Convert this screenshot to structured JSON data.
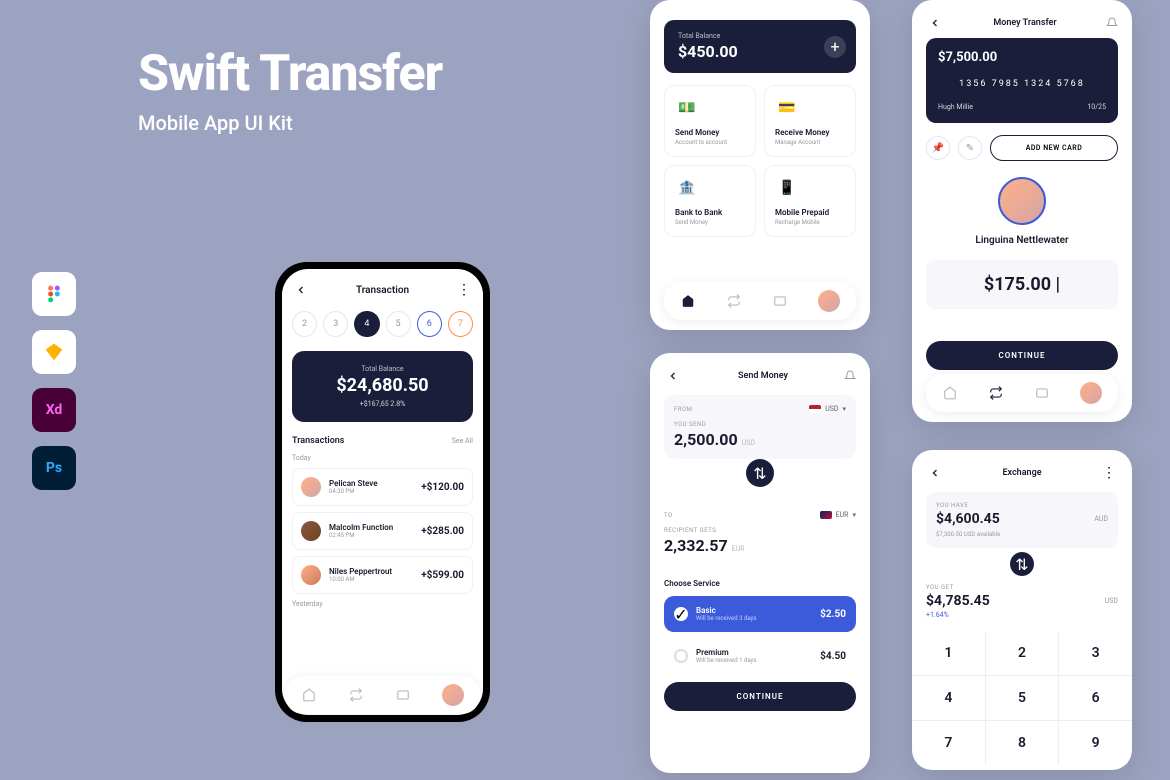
{
  "hero": {
    "title": "Swift Transfer",
    "subtitle": "Mobile App UI Kit"
  },
  "tools": [
    "Figma",
    "Sketch",
    "XD",
    "Photoshop"
  ],
  "transaction_screen": {
    "title": "Transaction",
    "tabs": [
      "2",
      "3",
      "4",
      "5",
      "6",
      "7"
    ],
    "active_tab": "4",
    "balance_label": "Total Balance",
    "balance": "$24,680.50",
    "change": "+$167,65   2.8%",
    "section": "Transactions",
    "see_all": "See All",
    "today": "Today",
    "yesterday": "Yesterday",
    "items": [
      {
        "name": "Pelican Steve",
        "time": "04:30 PM",
        "amount": "+$120.00"
      },
      {
        "name": "Malcolm Function",
        "time": "02:45 PM",
        "amount": "+$285.00"
      },
      {
        "name": "Niles Peppertrout",
        "time": "10:00 AM",
        "amount": "+$599.00"
      }
    ]
  },
  "home_screen": {
    "balance_label": "Total Balance",
    "balance": "$450.00",
    "actions": [
      {
        "title": "Send Money",
        "sub": "Account to account"
      },
      {
        "title": "Receive Money",
        "sub": "Manage Account"
      },
      {
        "title": "Bank to Bank",
        "sub": "Send Money"
      },
      {
        "title": "Mobile Prepaid",
        "sub": "Recharge Mobile"
      }
    ]
  },
  "send_screen": {
    "title": "Send Money",
    "from": "FROM",
    "from_currency": "USD",
    "you_send": "YOU SEND",
    "send_amount": "2,500.00",
    "send_cur": "USD",
    "to": "TO",
    "to_currency": "EUR",
    "recipient_gets": "RECIPIENT GETS",
    "receive_amount": "2,332.57",
    "receive_cur": "EUR",
    "choose": "Choose Service",
    "services": [
      {
        "name": "Basic",
        "sub": "Will be received 3 days",
        "price": "$2.50"
      },
      {
        "name": "Premium",
        "sub": "Will be received 1 days",
        "price": "$4.50"
      }
    ],
    "continue": "CONTINUE"
  },
  "transfer_screen": {
    "title": "Money Transfer",
    "cc_balance": "$7,500.00",
    "cc_number": "1356   7985   1324   5768",
    "cc_name": "Hugh Millie",
    "cc_exp": "10/25",
    "add_card": "ADD NEW CARD",
    "profile_name": "Linguina Nettlewater",
    "amount": "$175.00 |",
    "continue": "CONTINUE"
  },
  "exchange_screen": {
    "title": "Exchange",
    "you_have": "YOU HAVE",
    "have_amount": "$4,600.45",
    "have_cur": "AUD",
    "available": "$7,300.50 USD available",
    "you_get": "YOU GET",
    "get_amount": "$4,785.45",
    "get_cur": "USD",
    "change": "+1.64%",
    "keys": [
      "1",
      "2",
      "3",
      "4",
      "5",
      "6",
      "7",
      "8",
      "9"
    ]
  }
}
